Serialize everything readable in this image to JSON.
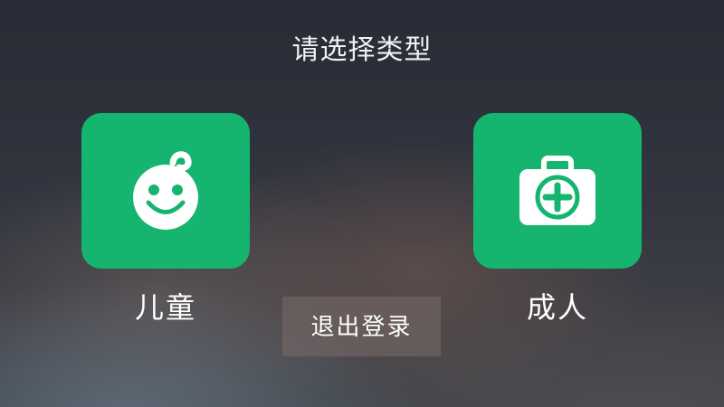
{
  "dialog": {
    "title": "请选择类型"
  },
  "options": [
    {
      "label": "儿童",
      "icon": "baby-face-icon"
    },
    {
      "label": "成人",
      "icon": "medical-kit-icon"
    }
  ],
  "actions": {
    "logout_label": "退出登录"
  },
  "colors": {
    "accent": "#15b56f",
    "text": "#ffffff"
  }
}
